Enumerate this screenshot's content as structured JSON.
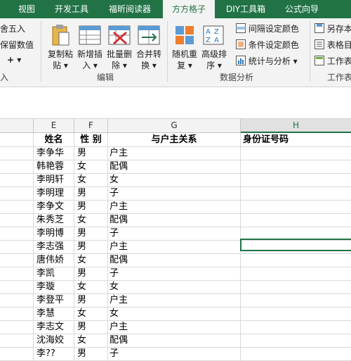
{
  "tabs": [
    {
      "label": "视图",
      "active": false
    },
    {
      "label": "开发工具",
      "active": false
    },
    {
      "label": "福昕阅读器",
      "active": false
    },
    {
      "label": "方方格子",
      "active": true
    },
    {
      "label": "DIY工具箱",
      "active": false
    },
    {
      "label": "公式向导",
      "active": false
    }
  ],
  "ribbon": {
    "left_items": [
      "舍五入",
      "保留数值",
      "+ ▾",
      "入"
    ],
    "edit_group": {
      "label": "编辑",
      "buttons": [
        {
          "label1": "复制粘",
          "label2": "贴 ▾",
          "icon": "paste-icon"
        },
        {
          "label1": "新增插",
          "label2": "入 ▾",
          "icon": "insert-table-icon"
        },
        {
          "label1": "批量删",
          "label2": "除 ▾",
          "icon": "batch-delete-icon"
        },
        {
          "label1": "合并转",
          "label2": "换 ▾",
          "icon": "merge-convert-icon"
        }
      ]
    },
    "analysis_group": {
      "label": "数据分析",
      "buttons": [
        {
          "label1": "随机重",
          "label2": "复 ▾",
          "icon": "random-repeat-icon"
        },
        {
          "label1": "高级排",
          "label2": "序 ▾",
          "icon": "advanced-sort-icon"
        }
      ],
      "small_buttons": [
        {
          "label": "间隔设定颜色",
          "icon": "interval-color-icon"
        },
        {
          "label": "条件设定颜色",
          "icon": "condition-color-icon"
        },
        {
          "label": "统计与分析 ▾",
          "icon": "statistics-icon"
        }
      ]
    },
    "right_group": {
      "label": "工作表",
      "small_buttons": [
        {
          "label": "另存本",
          "icon": "save-as-icon"
        },
        {
          "label": "表格目",
          "icon": "table-directory-icon"
        },
        {
          "label": "工作表",
          "icon": "worksheet-icon"
        }
      ]
    }
  },
  "columns": [
    "E",
    "F",
    "G",
    "H"
  ],
  "selected_column": "H",
  "table_headers": [
    "姓名",
    "性 别",
    "与户主关系",
    "身份证号码"
  ],
  "rows": [
    [
      "李争华",
      "男",
      "户主",
      ""
    ],
    [
      "韩艳蓉",
      "女",
      "配偶",
      ""
    ],
    [
      "李明轩",
      "女",
      "女",
      ""
    ],
    [
      "李明理",
      "男",
      "子",
      ""
    ],
    [
      "李争文",
      "男",
      "户主",
      ""
    ],
    [
      "朱秀芝",
      "女",
      "配偶",
      ""
    ],
    [
      "李明博",
      "男",
      "子",
      ""
    ],
    [
      "李志强",
      "男",
      "户主",
      ""
    ],
    [
      "唐伟娇",
      "女",
      "配偶",
      ""
    ],
    [
      "李凯",
      "男",
      "子",
      ""
    ],
    [
      "李璇",
      "女",
      "女",
      ""
    ],
    [
      "李登平",
      "男",
      "户主",
      ""
    ],
    [
      "李慧",
      "女",
      "女",
      ""
    ],
    [
      "李志文",
      "男",
      "户主",
      ""
    ],
    [
      "沈海姣",
      "女",
      "配偶",
      ""
    ],
    [
      "李??",
      "男",
      "子",
      ""
    ]
  ],
  "colors": {
    "accent": "#217346",
    "ribbon_bg": "#f3f3f3",
    "grid_line": "#d9d9d9"
  }
}
